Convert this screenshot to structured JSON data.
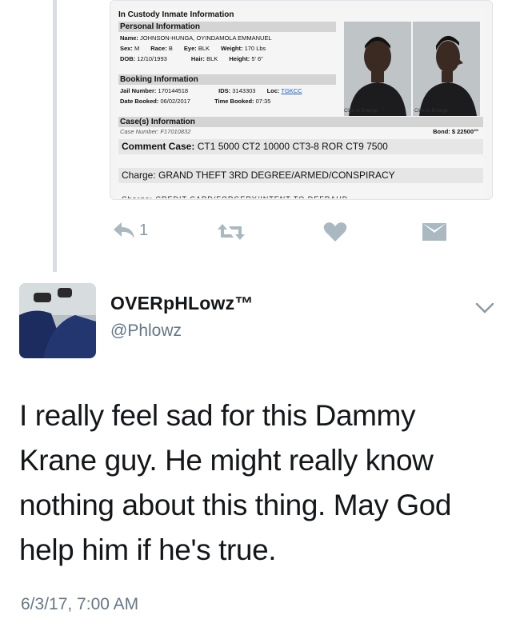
{
  "card": {
    "title": "In Custody Inmate Information",
    "personal_header": "Personal Information",
    "name_label": "Name:",
    "name_value": "JOHNSON-HUNGA, OYINDAMOLA EMMANUEL",
    "sex_label": "Sex:",
    "sex_value": "M",
    "race_label": "Race:",
    "race_value": "B",
    "eye_label": "Eye:",
    "eye_value": "BLK",
    "weight_label": "Weight:",
    "weight_value": "170 Lbs",
    "dob_label": "DOB:",
    "dob_value": "12/10/1993",
    "hair_label": "Hair:",
    "hair_value": "BLK",
    "height_label": "Height:",
    "height_value": "5'  6\"",
    "booking_header": "Booking Information",
    "jail_label": "Jail Number:",
    "jail_value": "170144518",
    "ids_label": "IDS:",
    "ids_value": "3143303",
    "loc_label": "Loc:",
    "loc_value": "TGKCC",
    "date_booked_label": "Date Booked:",
    "date_booked_value": "06/02/2017",
    "time_booked_label": "Time Booked:",
    "time_booked_value": "07:35",
    "click_enlarge_1": "Click to Enlarge",
    "click_enlarge_2": "Click to Enlarge",
    "cases_header": "Case(s) Information",
    "case_number": "Case Number: F17010832",
    "bond": "Bond: $ 22500°°",
    "comment_label": "Comment Case:",
    "comment_value": "CT1 5000 CT2 10000 CT3-8 ROR CT9 7500",
    "charge_label": "Charge:",
    "charge_value": "GRAND THEFT 3RD DEGREE/ARMED/CONSPIRACY",
    "cut_line": "Charge: CREDIT CARD/FORGERY/INTENT TO DEFRAUD"
  },
  "actions": {
    "reply_count": "1",
    "icon_color": "#aab8c2"
  },
  "tweet": {
    "display_name": "OVERpHLowz™",
    "handle": "@Phlowz",
    "text": "I really feel sad for this Dammy Krane guy. He might really know nothing about this thing. May God help him if he's true.",
    "timestamp": "6/3/17, 7:00 AM"
  },
  "icons": [
    "reply-icon",
    "retweet-icon",
    "like-icon",
    "direct-message-icon",
    "chevron-down-icon"
  ]
}
